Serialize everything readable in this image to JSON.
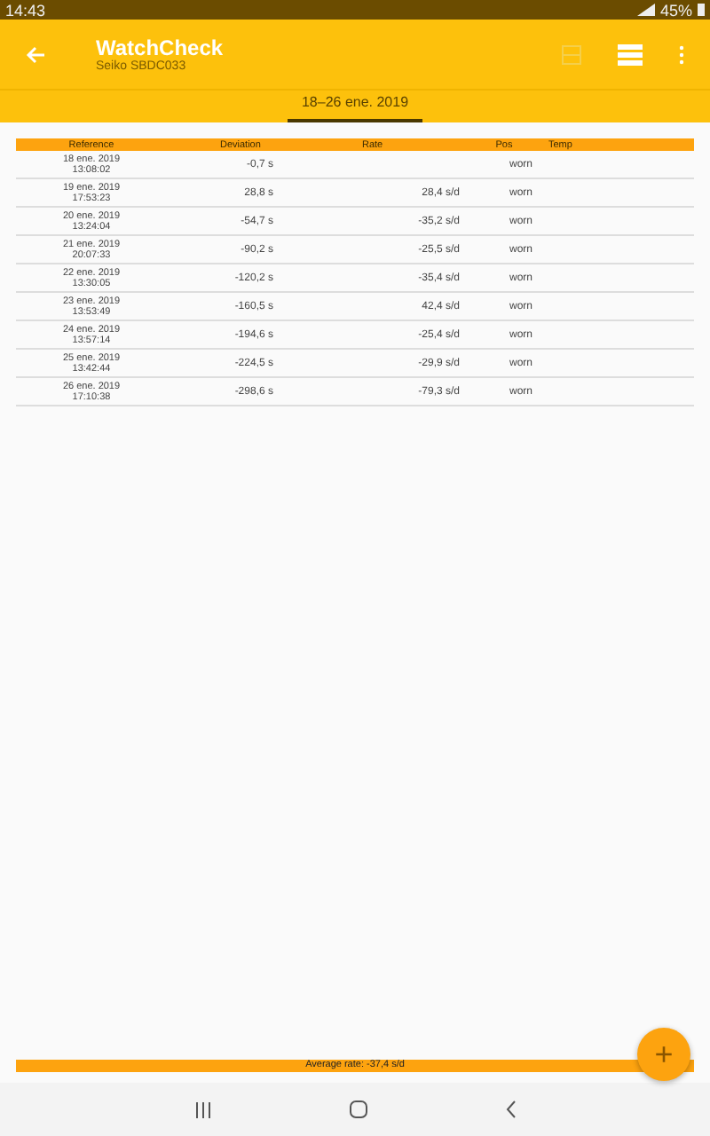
{
  "status_bar": {
    "time": "14:43",
    "battery": "45%"
  },
  "app_bar": {
    "title": "WatchCheck",
    "subtitle": "Seiko SBDC033"
  },
  "tabs": [
    {
      "label": "18–26 ene. 2019",
      "selected": true
    }
  ],
  "table": {
    "columns": [
      "Reference",
      "Deviation",
      "Rate",
      "Pos",
      "Temp"
    ],
    "rows": [
      {
        "date": "18 ene. 2019",
        "time": "13:08:02",
        "deviation": "-0,7 s",
        "rate": "",
        "pos": "worn"
      },
      {
        "date": "19 ene. 2019",
        "time": "17:53:23",
        "deviation": "28,8 s",
        "rate": "28,4 s/d",
        "pos": "worn"
      },
      {
        "date": "20 ene. 2019",
        "time": "13:24:04",
        "deviation": "-54,7 s",
        "rate": "-35,2 s/d",
        "pos": "worn"
      },
      {
        "date": "21 ene. 2019",
        "time": "20:07:33",
        "deviation": "-90,2 s",
        "rate": "-25,5 s/d",
        "pos": "worn"
      },
      {
        "date": "22 ene. 2019",
        "time": "13:30:05",
        "deviation": "-120,2 s",
        "rate": "-35,4 s/d",
        "pos": "worn"
      },
      {
        "date": "23 ene. 2019",
        "time": "13:53:49",
        "deviation": "-160,5 s",
        "rate": "42,4 s/d",
        "pos": "worn"
      },
      {
        "date": "24 ene. 2019",
        "time": "13:57:14",
        "deviation": "-194,6 s",
        "rate": "-25,4 s/d",
        "pos": "worn"
      },
      {
        "date": "25 ene. 2019",
        "time": "13:42:44",
        "deviation": "-224,5 s",
        "rate": "-29,9 s/d",
        "pos": "worn"
      },
      {
        "date": "26 ene. 2019",
        "time": "17:10:38",
        "deviation": "-298,6 s",
        "rate": "-79,3 s/d",
        "pos": "worn"
      }
    ]
  },
  "footer": {
    "average": "Average rate: -37,4 s/d"
  },
  "fab": {
    "label": "+"
  }
}
